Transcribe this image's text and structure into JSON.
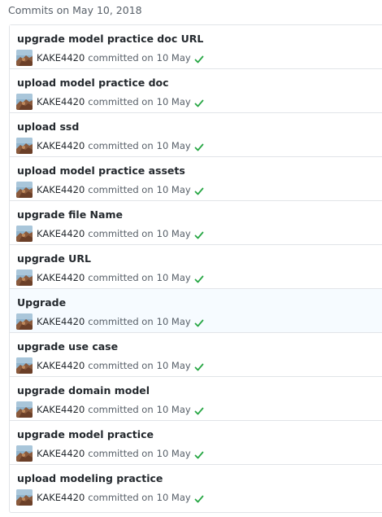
{
  "heading": "Commits on May 10, 2018",
  "colors": {
    "border": "#e1e4e8",
    "success": "#28a745",
    "muted": "#586069",
    "highlight_row": "#f6fbff"
  },
  "commit_meta": {
    "committed_text": "committed on"
  },
  "commits": [
    {
      "title": "upgrade model practice doc URL",
      "author": "KAKE4420",
      "date": "10 May",
      "status": "success"
    },
    {
      "title": "upload model practice doc",
      "author": "KAKE4420",
      "date": "10 May",
      "status": "success"
    },
    {
      "title": "upload ssd",
      "author": "KAKE4420",
      "date": "10 May",
      "status": "success"
    },
    {
      "title": "upload model practice assets",
      "author": "KAKE4420",
      "date": "10 May",
      "status": "success"
    },
    {
      "title": "upgrade file Name",
      "author": "KAKE4420",
      "date": "10 May",
      "status": "success"
    },
    {
      "title": "upgrade URL",
      "author": "KAKE4420",
      "date": "10 May",
      "status": "success"
    },
    {
      "title": "Upgrade",
      "author": "KAKE4420",
      "date": "10 May",
      "status": "success",
      "hovered": true
    },
    {
      "title": "upgrade use case",
      "author": "KAKE4420",
      "date": "10 May",
      "status": "success"
    },
    {
      "title": "upgrade domain model",
      "author": "KAKE4420",
      "date": "10 May",
      "status": "success"
    },
    {
      "title": "upgrade model practice",
      "author": "KAKE4420",
      "date": "10 May",
      "status": "success"
    },
    {
      "title": "upload modeling practice",
      "author": "KAKE4420",
      "date": "10 May",
      "status": "success"
    }
  ]
}
